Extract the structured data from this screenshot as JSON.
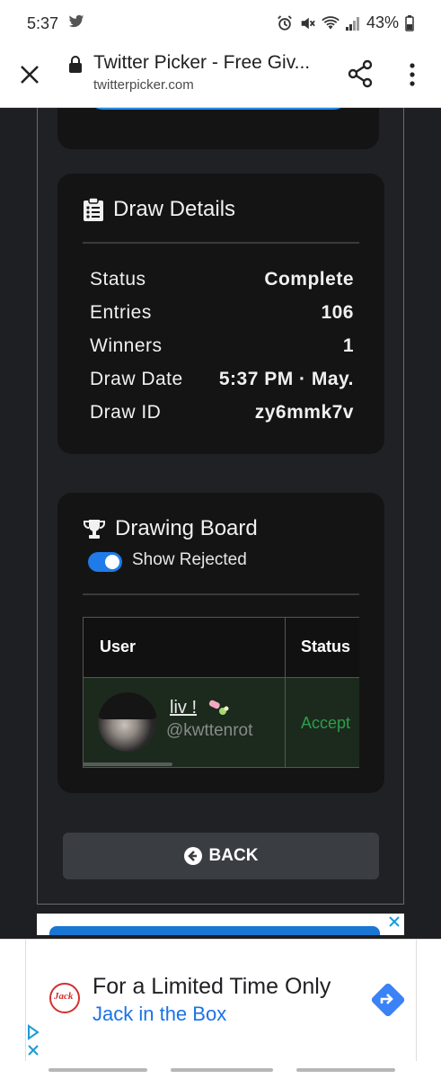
{
  "status_bar": {
    "time": "5:37",
    "battery": "43%",
    "icons": [
      "twitter-icon",
      "alarm-icon",
      "mute-icon",
      "wifi-icon",
      "signal-icon",
      "battery-icon"
    ]
  },
  "browser": {
    "title": "Twitter Picker - Free Giv...",
    "url": "twitterpicker.com",
    "icons": [
      "close-icon",
      "lock-icon",
      "share-icon",
      "more-vert-icon"
    ]
  },
  "draw_details": {
    "title": "Draw Details",
    "icon": "clipboard-list-icon",
    "rows": [
      {
        "label": "Status",
        "value": "Complete"
      },
      {
        "label": "Entries",
        "value": "106"
      },
      {
        "label": "Winners",
        "value": "1"
      },
      {
        "label": "Draw Date",
        "value": "5:37 PM · May."
      },
      {
        "label": "Draw ID",
        "value": "zy6mmk7v"
      }
    ]
  },
  "drawing_board": {
    "title": "Drawing Board",
    "icon": "trophy-icon",
    "toggle_label": "Show Rejected",
    "toggle_on": true,
    "columns": [
      "User",
      "Status"
    ],
    "rows": [
      {
        "name": "liv !",
        "handle": "@kwttenrot",
        "status": "Accept"
      }
    ]
  },
  "back_button": {
    "label": "BACK",
    "icon": "arrow-circle-left-icon"
  },
  "ad": {
    "headline": "For a Limited Time Only",
    "advertiser": "Jack in the Box",
    "logo_text": "Jack",
    "icons": [
      "adchoices-icon",
      "close-icon",
      "directions-arrow-icon"
    ]
  },
  "colors": {
    "accent": "#1e7be8",
    "accepted": "#2e9e4a",
    "card_bg": "#141414",
    "page_bg": "#1e1f22"
  }
}
